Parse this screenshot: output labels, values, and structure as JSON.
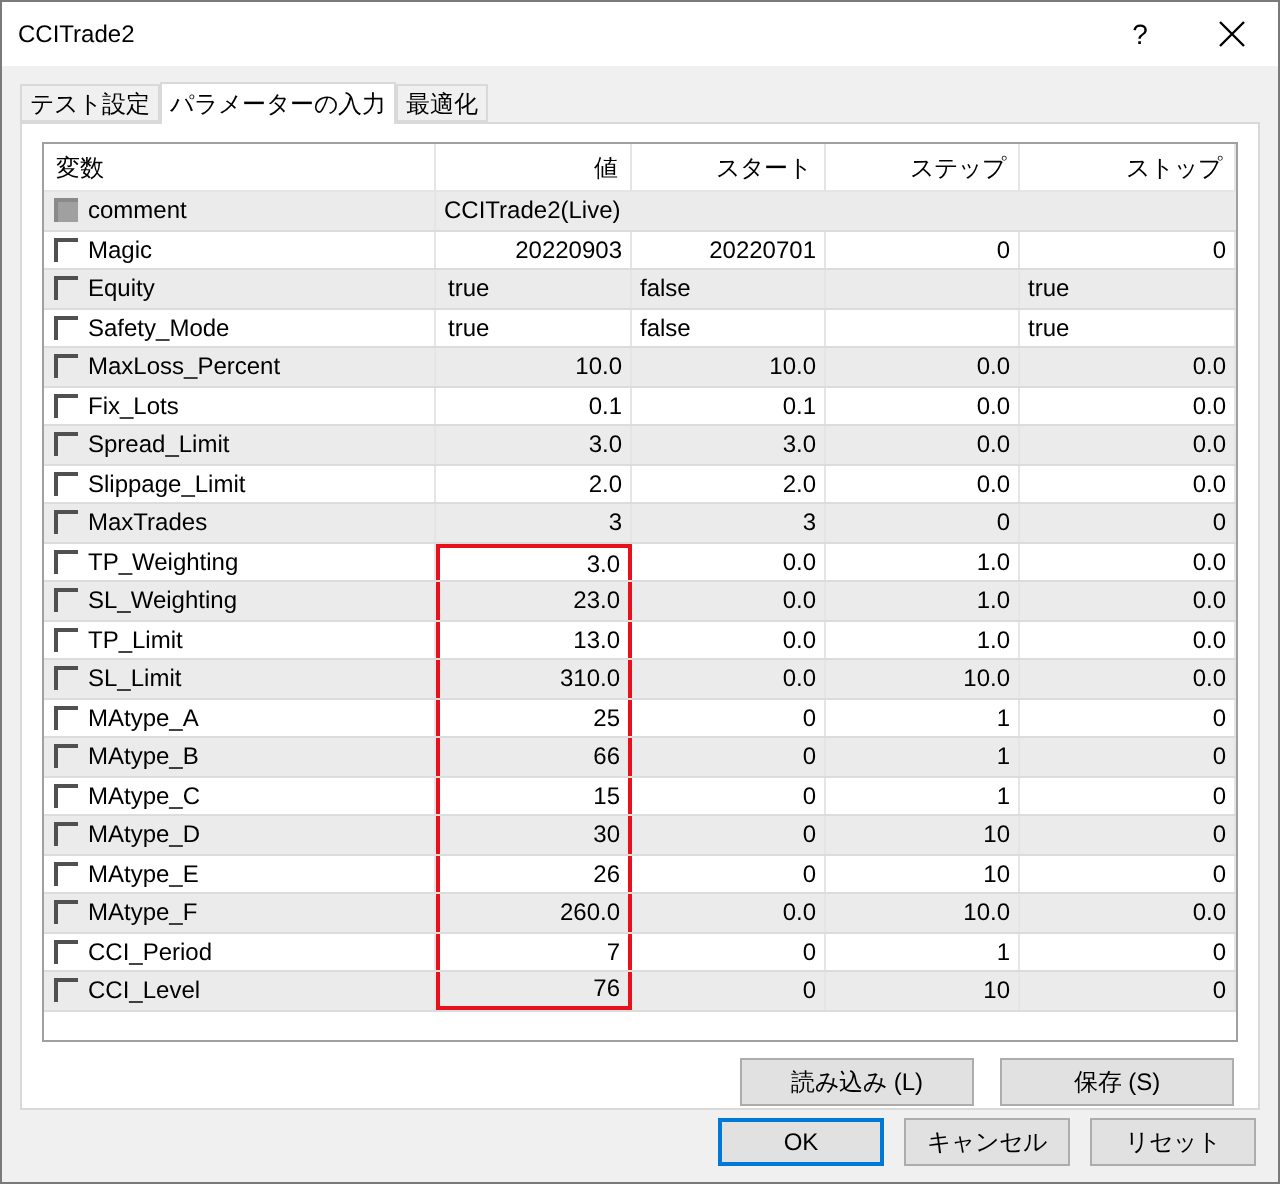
{
  "window": {
    "title": "CCITrade2",
    "help": "?"
  },
  "tabs": [
    {
      "label": "テスト設定",
      "selected": false
    },
    {
      "label": "パラメーターの入力",
      "selected": true
    },
    {
      "label": "最適化",
      "selected": false
    }
  ],
  "table": {
    "columns": [
      "変数",
      "値",
      "スタート",
      "ステップ",
      "ストップ"
    ],
    "rows": [
      {
        "name": "comment",
        "checked": false,
        "disabled": true,
        "kind": "text",
        "value": "CCITrade2(Live)"
      },
      {
        "name": "Magic",
        "checked": false,
        "disabled": false,
        "kind": "number",
        "value": "20220903",
        "start": "20220701",
        "step": "0",
        "stop": "0",
        "highlighted": false
      },
      {
        "name": "Equity",
        "checked": false,
        "disabled": false,
        "kind": "bool",
        "value": "true",
        "start": "false",
        "stop": "true",
        "highlighted": false
      },
      {
        "name": "Safety_Mode",
        "checked": false,
        "disabled": false,
        "kind": "bool",
        "value": "true",
        "start": "false",
        "stop": "true",
        "highlighted": false
      },
      {
        "name": "MaxLoss_Percent",
        "checked": false,
        "disabled": false,
        "kind": "number",
        "value": "10.0",
        "start": "10.0",
        "step": "0.0",
        "stop": "0.0",
        "highlighted": false
      },
      {
        "name": "Fix_Lots",
        "checked": false,
        "disabled": false,
        "kind": "number",
        "value": "0.1",
        "start": "0.1",
        "step": "0.0",
        "stop": "0.0",
        "highlighted": false
      },
      {
        "name": "Spread_Limit",
        "checked": false,
        "disabled": false,
        "kind": "number",
        "value": "3.0",
        "start": "3.0",
        "step": "0.0",
        "stop": "0.0",
        "highlighted": false
      },
      {
        "name": "Slippage_Limit",
        "checked": false,
        "disabled": false,
        "kind": "number",
        "value": "2.0",
        "start": "2.0",
        "step": "0.0",
        "stop": "0.0",
        "highlighted": false
      },
      {
        "name": "MaxTrades",
        "checked": false,
        "disabled": false,
        "kind": "number",
        "value": "3",
        "start": "3",
        "step": "0",
        "stop": "0",
        "highlighted": false
      },
      {
        "name": "TP_Weighting",
        "checked": false,
        "disabled": false,
        "kind": "number",
        "value": "3.0",
        "start": "0.0",
        "step": "1.0",
        "stop": "0.0",
        "highlighted": true
      },
      {
        "name": "SL_Weighting",
        "checked": false,
        "disabled": false,
        "kind": "number",
        "value": "23.0",
        "start": "0.0",
        "step": "1.0",
        "stop": "0.0",
        "highlighted": true
      },
      {
        "name": "TP_Limit",
        "checked": false,
        "disabled": false,
        "kind": "number",
        "value": "13.0",
        "start": "0.0",
        "step": "1.0",
        "stop": "0.0",
        "highlighted": true
      },
      {
        "name": "SL_Limit",
        "checked": false,
        "disabled": false,
        "kind": "number",
        "value": "310.0",
        "start": "0.0",
        "step": "10.0",
        "stop": "0.0",
        "highlighted": true
      },
      {
        "name": "MAtype_A",
        "checked": false,
        "disabled": false,
        "kind": "number",
        "value": "25",
        "start": "0",
        "step": "1",
        "stop": "0",
        "highlighted": true
      },
      {
        "name": "MAtype_B",
        "checked": false,
        "disabled": false,
        "kind": "number",
        "value": "66",
        "start": "0",
        "step": "1",
        "stop": "0",
        "highlighted": true
      },
      {
        "name": "MAtype_C",
        "checked": false,
        "disabled": false,
        "kind": "number",
        "value": "15",
        "start": "0",
        "step": "1",
        "stop": "0",
        "highlighted": true
      },
      {
        "name": "MAtype_D",
        "checked": false,
        "disabled": false,
        "kind": "number",
        "value": "30",
        "start": "0",
        "step": "10",
        "stop": "0",
        "highlighted": true
      },
      {
        "name": "MAtype_E",
        "checked": false,
        "disabled": false,
        "kind": "number",
        "value": "26",
        "start": "0",
        "step": "10",
        "stop": "0",
        "highlighted": true
      },
      {
        "name": "MAtype_F",
        "checked": false,
        "disabled": false,
        "kind": "number",
        "value": "260.0",
        "start": "0.0",
        "step": "10.0",
        "stop": "0.0",
        "highlighted": true
      },
      {
        "name": "CCI_Period",
        "checked": false,
        "disabled": false,
        "kind": "number",
        "value": "7",
        "start": "0",
        "step": "1",
        "stop": "0",
        "highlighted": true
      },
      {
        "name": "CCI_Level",
        "checked": false,
        "disabled": false,
        "kind": "number",
        "value": "76",
        "start": "0",
        "step": "10",
        "stop": "0",
        "highlighted": true
      }
    ]
  },
  "panel_buttons": [
    "読み込み (L)",
    "保存 (S)"
  ],
  "dialog_buttons": [
    {
      "label": "OK",
      "default": true
    },
    {
      "label": "キャンセル",
      "default": false
    },
    {
      "label": "リセット",
      "default": false
    }
  ]
}
